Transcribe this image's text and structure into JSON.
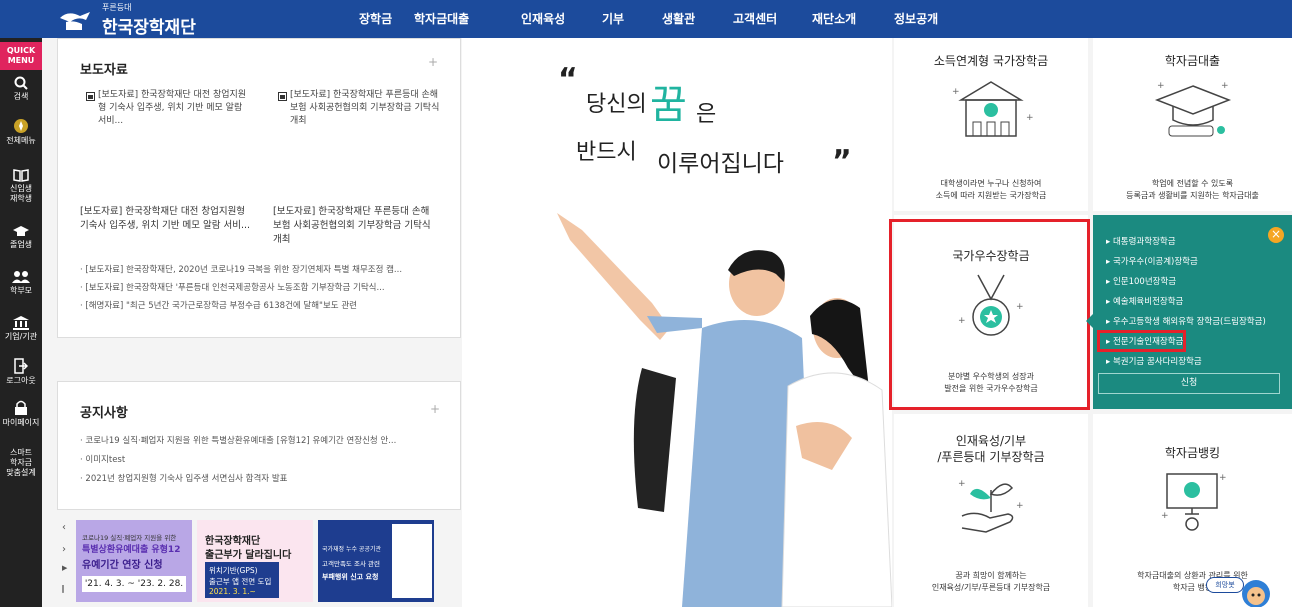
{
  "header": {
    "logo_sub": "푸른등대",
    "logo_text": "한국장학재단",
    "nav": [
      "장학금",
      "학자금대출",
      "인재육성",
      "기부",
      "생활관",
      "고객센터",
      "재단소개",
      "정보공개"
    ]
  },
  "quick": {
    "title": "QUICK MENU",
    "items": [
      "검색",
      "전체메뉴",
      "신입생 재학생",
      "졸업생",
      "학부모",
      "기업/기관",
      "로그아웃",
      "마이페이지",
      "스마트 학자금 맞춤설계"
    ]
  },
  "press": {
    "title": "보도자료",
    "plus": "+",
    "thumb1": "[보도자료] 한국장학재단 대전 창업지원형 기숙사 입주생, 위치 기반 메모 알람 서비...",
    "thumb2": "[보도자료] 한국장학재단 푸른등대 손해보험 사회공헌협의회 기부장학금 기탁식 개최",
    "large1": "[보도자료] 한국장학재단 대전 창업지원형 기숙사 입주생, 위치 기반 메모 알람 서비...",
    "large2": "[보도자료] 한국장학재단 푸른등대 손해보험 사회공헌협의회 기부장학금 기탁식 개최",
    "list": [
      "[보도자료] 한국장학재단, 2020년 코로나19 극복을 위한 장기연체자 특별 채무조정 캠...",
      "[보도자료] 한국장학재단 '푸른등대 인천국제공항공사 노동조합 기부장학금 기탁식...",
      "[해명자료] \"최근 5년간 국가근로장학금 부정수급 6138건에 달해\"보도 관련"
    ]
  },
  "notice": {
    "title": "공지사항",
    "plus": "+",
    "list": [
      "코로나19 실직·폐업자 지원을 위한 특별상환유예대출 [유형12] 유예기간 연장신청 안...",
      "이미지test",
      "2021년 창업지원형 기숙사 입주생 서면심사 합격자 발표"
    ]
  },
  "banners": {
    "b1_line1": "코로나19 실직·폐업자 지원을 위한",
    "b1_line2": "특별상환유예대출 유형12",
    "b1_line3": "유예기간 연장 신청",
    "b1_date": "'21. 4. 3. ~ '23. 2. 28.",
    "b2_line1": "한국장학재단",
    "b2_line2": "출근부가 달라집니다",
    "b2_line3": "위치기반(GPS)",
    "b2_line4": "출근부 앱 전면 도입",
    "b2_date": "2021. 3. 1.~",
    "b3_line1": "국가재정 누수 공공기관",
    "b3_line2": "고객만족도 조사 관련",
    "b3_line3": "부패행위 신고 요청"
  },
  "hero": {
    "open_quote": "“",
    "line1a": "당신의",
    "dream": "꿈",
    "line1b": "은",
    "line2a": "반드시",
    "line2b": "이루어집니다",
    "close_quote": "”"
  },
  "tiles": {
    "t1_title": "소득연계형 국가장학금",
    "t1_desc1": "대학생이라면 누구나 신청하여",
    "t1_desc2": "소득에 따라 지원받는 국가장학금",
    "t2_title": "학자금대출",
    "t2_desc1": "학업에 전념할 수 있도록",
    "t2_desc2": "등록금과 생활비를 지원하는 학자금대출",
    "t3_title": "국가우수장학금",
    "t3_desc1": "분야별 우수학생의 성장과",
    "t3_desc2": "발전을 위한 국가우수장학금",
    "t4_title1": "인재육성/기부",
    "t4_title2": "/푸른등대 기부장학금",
    "t4_desc1": "꿈과 희망이 함께하는",
    "t4_desc2": "인재육성/기부/푸른등대 기부장학금",
    "t5_title": "학자금뱅킹",
    "t5_desc1": "학자금대출의 상환과 관리를 위한",
    "t5_desc2": "학자금 뱅킹",
    "chatbot": "희망봇"
  },
  "submenu": {
    "items": [
      "대통령과학장학금",
      "국가우수(이공계)장학금",
      "인문100년장학금",
      "예술체육비전장학금",
      "우수고등학생 해외유학 장학금(드림장학금)",
      "전문기술인재장학금",
      "복권기금 꿈사다리장학금"
    ],
    "apply": "신청",
    "close": "×"
  },
  "colors": {
    "header": "#1c4b9c",
    "teal": "#1b8a80",
    "highlight": "#e5212a",
    "accent": "#2bbfa0"
  }
}
